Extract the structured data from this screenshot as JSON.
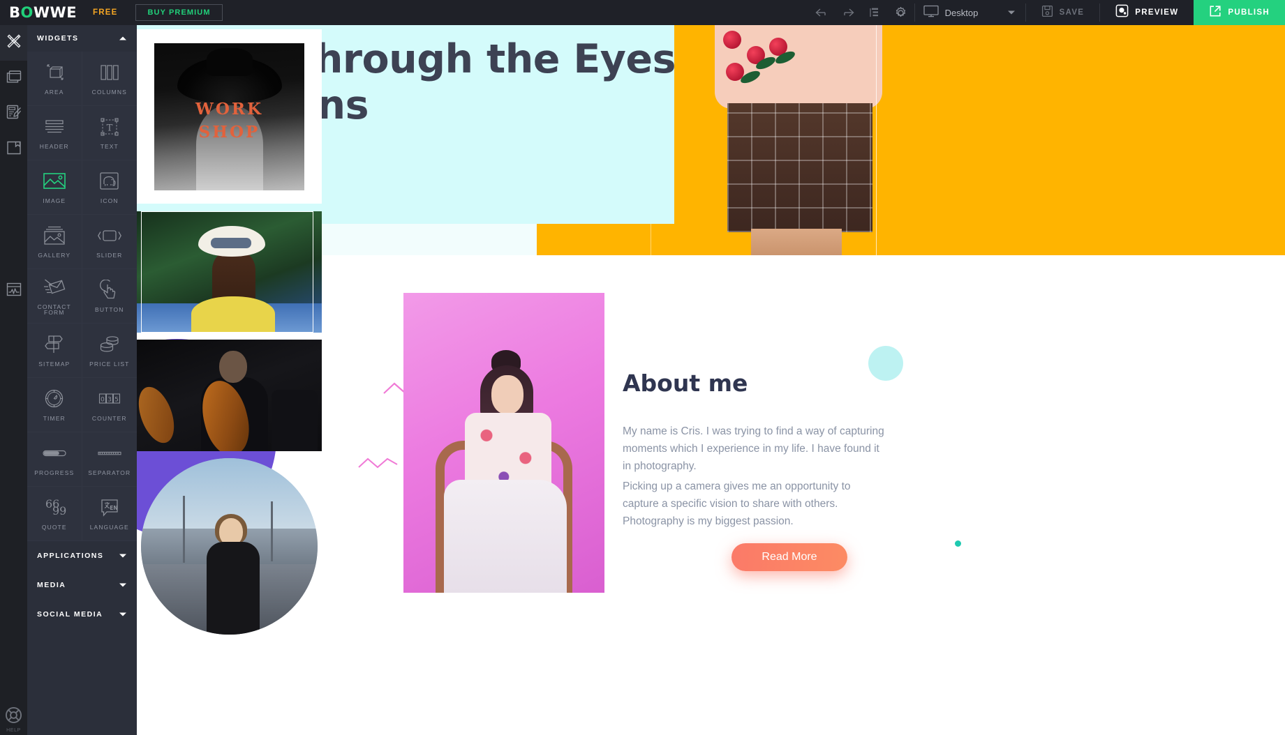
{
  "topbar": {
    "logo": "BOWWE",
    "plan_label": "FREE",
    "buy_premium_label": "BUY PREMIUM",
    "undo_icon": "undo-icon",
    "redo_icon": "redo-icon",
    "layers_icon": "layers-icon",
    "settings_icon": "gear-icon",
    "device_icon": "desktop-monitor-icon",
    "device_value": "Desktop",
    "device_caret_icon": "chevron-down-icon",
    "save_label": "SAVE",
    "save_icon": "floppy-disk-icon",
    "preview_label": "PREVIEW",
    "preview_icon": "eye-icon",
    "publish_label": "PUBLISH",
    "publish_icon": "external-link-icon",
    "accent_green": "#24d17f",
    "accent_orange": "#f5a623",
    "bar_bg": "#1f2128"
  },
  "rail": {
    "items": [
      {
        "name": "design-tools",
        "icon": "ruler-pencil-icon",
        "active": true
      },
      {
        "name": "pages",
        "icon": "windows-stack-icon",
        "active": false
      },
      {
        "name": "content-editor",
        "icon": "note-pencil-icon",
        "active": false
      },
      {
        "name": "files",
        "icon": "folder-icon",
        "active": false
      },
      {
        "name": "analytics",
        "icon": "chart-window-icon",
        "active": false
      }
    ],
    "help_label": "HELP",
    "help_icon": "lifebuoy-icon"
  },
  "panel": {
    "header": {
      "title": "WIDGETS",
      "caret_icon": "chevron-up-icon"
    },
    "widgets": [
      {
        "label": "AREA",
        "icon": "area-box-icon",
        "highlighted": false
      },
      {
        "label": "COLUMNS",
        "icon": "columns-icon",
        "highlighted": false
      },
      {
        "label": "HEADER",
        "icon": "header-lines-icon",
        "highlighted": false
      },
      {
        "label": "TEXT",
        "icon": "text-box-icon",
        "highlighted": false
      },
      {
        "label": "IMAGE",
        "icon": "image-icon",
        "highlighted": true
      },
      {
        "label": "ICON",
        "icon": "elephant-icon",
        "highlighted": false
      },
      {
        "label": "GALLERY",
        "icon": "gallery-icon",
        "highlighted": false
      },
      {
        "label": "SLIDER",
        "icon": "slider-icon",
        "highlighted": false
      },
      {
        "label": "CONTACT FORM",
        "icon": "envelope-pencil-icon",
        "highlighted": false
      },
      {
        "label": "BUTTON",
        "icon": "hand-click-icon",
        "highlighted": false
      },
      {
        "label": "SITEMAP",
        "icon": "signpost-icon",
        "highlighted": false
      },
      {
        "label": "PRICE LIST",
        "icon": "coins-icon",
        "highlighted": false
      },
      {
        "label": "TIMER",
        "icon": "stopwatch-icon",
        "highlighted": false
      },
      {
        "label": "COUNTER",
        "icon": "counter-digits-icon",
        "highlighted": false
      },
      {
        "label": "PROGRESS",
        "icon": "progress-bar-icon",
        "highlighted": false
      },
      {
        "label": "SEPARATOR",
        "icon": "separator-line-icon",
        "highlighted": false
      },
      {
        "label": "QUOTE",
        "icon": "quote-marks-icon",
        "highlighted": false
      },
      {
        "label": "LANGUAGE",
        "icon": "language-bubble-icon",
        "highlighted": false
      }
    ],
    "sections": [
      {
        "title": "APPLICATIONS",
        "caret_icon": "chevron-down-icon"
      },
      {
        "title": "MEDIA",
        "caret_icon": "chevron-down-icon"
      },
      {
        "title": "SOCIAL MEDIA",
        "caret_icon": "chevron-down-icon"
      }
    ],
    "panel_bg": "#2b2f3a",
    "cell_bg": "#2e323e",
    "highlight_color": "#24d17f"
  },
  "drag_stack": {
    "items": [
      {
        "name": "workshop-poster-image",
        "caption_line1": "WORK",
        "caption_line2": "SHOP",
        "selected": false
      },
      {
        "name": "woman-white-hat-image",
        "selected": true
      },
      {
        "name": "orchestra-cellist-image",
        "selected": false
      },
      {
        "name": "bridge-portrait-circle-image",
        "selected": false
      }
    ]
  },
  "canvas": {
    "hero": {
      "heading": "World, Through the Eyes of My Lens",
      "textbox_bg": "#d4fbfb",
      "accent_bg": "#ffb400"
    },
    "about": {
      "title": "About me",
      "paragraph_1": "My name is Cris. I was trying to find a way of capturing moments which I experience in my life. I have found it in photography.",
      "paragraph_2": "Picking up a camera gives me an opportunity to capture a specific vision to share with others. Photography is my biggest passion.",
      "button_label": "Read More",
      "button_color": "#fb7a68",
      "ring_color": "#6c4fd6",
      "dot_color": "#bdf2f2",
      "small_dot_color": "#1ec9b0"
    }
  }
}
